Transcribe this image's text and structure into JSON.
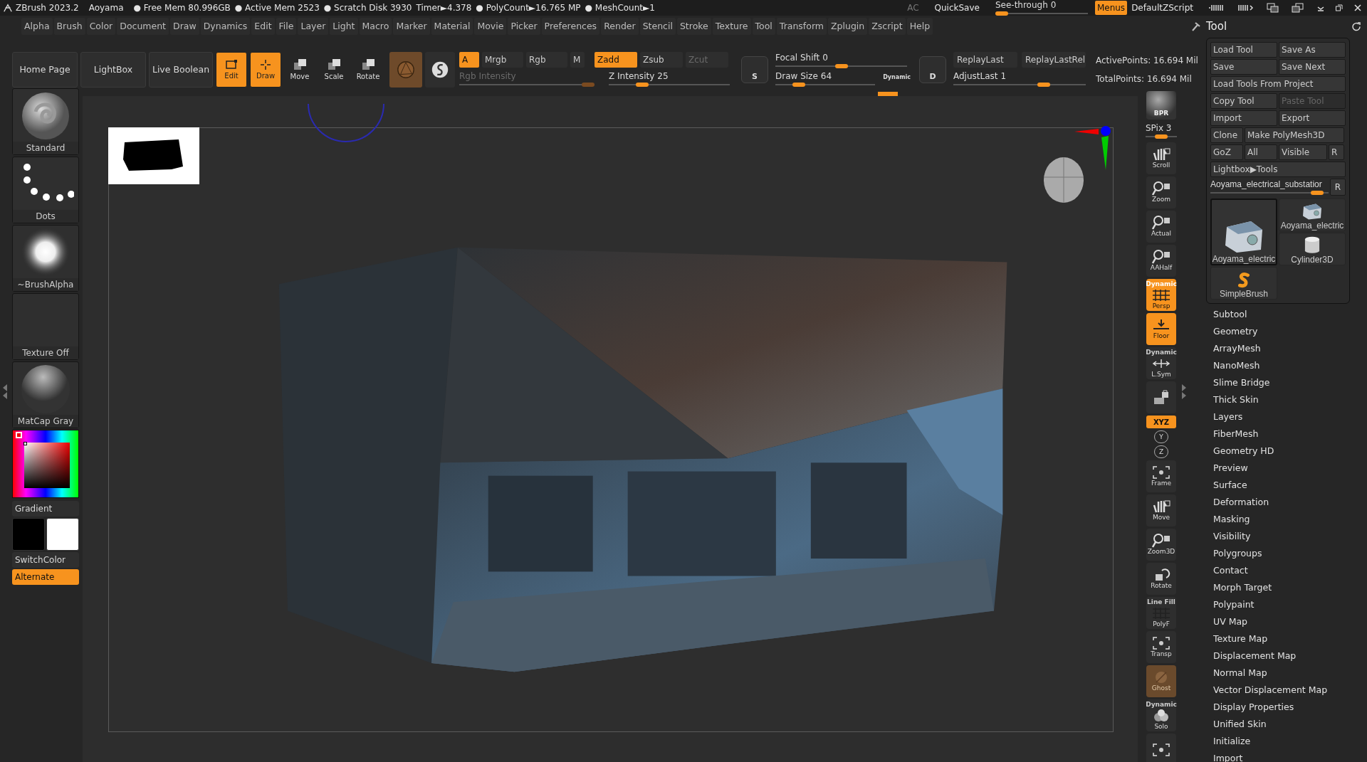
{
  "title_bar": {
    "app": "ZBrush 2023.2",
    "project": "Aoyama",
    "stats": [
      "● Free Mem 80.996GB",
      "● Active Mem 2523",
      "● Scratch Disk 3930",
      "Timer►4.378",
      "● PolyCount►16.765 MP",
      "● MeshCount►1"
    ],
    "ac": "AC",
    "quicksave": "QuickSave",
    "see_through": {
      "label": "See-through",
      "value": "0",
      "level": 0
    },
    "menus": {
      "label": "Menus",
      "on": true
    },
    "script": "DefaultZScript"
  },
  "menu": [
    "Alpha",
    "Brush",
    "Color",
    "Document",
    "Draw",
    "Dynamics",
    "Edit",
    "File",
    "Layer",
    "Light",
    "Macro",
    "Marker",
    "Material",
    "Movie",
    "Picker",
    "Preferences",
    "Render",
    "Stencil",
    "Stroke",
    "Texture",
    "Tool",
    "Transform",
    "Zplugin",
    "Zscript",
    "Help"
  ],
  "shelf": {
    "buttons": [
      "Home Page",
      "LightBox",
      "Live Boolean"
    ],
    "tools": [
      {
        "label": "Edit",
        "selected": true,
        "kind": "edit"
      },
      {
        "label": "Draw",
        "selected": true,
        "kind": "draw"
      },
      {
        "label": "Move",
        "selected": false,
        "kind": "move"
      },
      {
        "label": "Scale",
        "selected": false,
        "kind": "scale"
      },
      {
        "label": "Rotate",
        "selected": false,
        "kind": "rotate"
      }
    ],
    "color_modes": [
      {
        "label": "A",
        "on": true
      },
      {
        "label": "Mrgb",
        "on": false
      },
      {
        "label": "Rgb",
        "on": false
      },
      {
        "label": "M",
        "on": false
      }
    ],
    "z_modes": [
      {
        "label": "Zadd",
        "on": true,
        "disabled": false
      },
      {
        "label": "Zsub",
        "on": false,
        "disabled": false
      },
      {
        "label": "Zcut",
        "on": false,
        "disabled": true
      }
    ],
    "rgb_intensity": {
      "label": "Rgb Intensity",
      "disabled": true,
      "level": 1
    },
    "z_intensity": {
      "label": "Z Intensity",
      "value": "25",
      "level": 0.25
    },
    "s_button": "S",
    "d_button": "D",
    "focal_shift": {
      "label": "Focal Shift",
      "value": "0",
      "level": 0.5
    },
    "draw_size": {
      "label": "Draw Size",
      "value": "64",
      "level": 0.2,
      "tag": "Dynamic"
    },
    "replay": [
      "ReplayLast",
      "ReplayLastRel"
    ],
    "adjust_last": {
      "label": "AdjustLast",
      "value": "1",
      "level": 0.7
    },
    "points": [
      "ActivePoints: 16.694 Mil",
      "TotalPoints: 16.694 Mil"
    ]
  },
  "left_panel": {
    "thumbs": [
      {
        "label": "Standard",
        "kind": "brush"
      },
      {
        "label": "Dots",
        "kind": "stroke"
      },
      {
        "label": "~BrushAlpha",
        "kind": "alpha"
      },
      {
        "label": "Texture Off",
        "kind": "texture"
      },
      {
        "label": "MatCap Gray",
        "kind": "material"
      }
    ],
    "gradient": "Gradient",
    "switch_color": "SwitchColor",
    "alternate": {
      "label": "Alternate",
      "on": true
    }
  },
  "right_toolbar": [
    {
      "kind": "bpr",
      "label": "BPR"
    },
    {
      "kind": "slider",
      "label": "SPix 3",
      "level": 0.5
    },
    {
      "kind": "button",
      "label": "Scroll",
      "on": false
    },
    {
      "kind": "button",
      "label": "Zoom",
      "on": false
    },
    {
      "kind": "button",
      "label": "Actual",
      "on": false
    },
    {
      "kind": "button",
      "label": "AAHalf",
      "on": false
    },
    {
      "kind": "button",
      "label": "Persp",
      "top": "Dynamic",
      "on": true
    },
    {
      "kind": "button",
      "label": "Floor",
      "on": true
    },
    {
      "kind": "button",
      "label": "L.Sym",
      "top": "Dynamic",
      "on": false
    },
    {
      "kind": "button",
      "on": false
    },
    {
      "kind": "small",
      "label": "XYZ",
      "on": true
    },
    {
      "kind": "rot",
      "label": "Y"
    },
    {
      "kind": "rot",
      "label": "Z"
    },
    {
      "kind": "button",
      "label": "Frame",
      "on": false
    },
    {
      "kind": "button",
      "label": "Move",
      "on": false
    },
    {
      "kind": "button",
      "label": "Zoom3D",
      "on": false
    },
    {
      "kind": "button",
      "label": "Rotate",
      "on": false
    },
    {
      "kind": "button",
      "label": "PolyF",
      "top": "Line Fill",
      "on": false
    },
    {
      "kind": "button",
      "label": "Transp",
      "on": false
    },
    {
      "kind": "button",
      "label": "Ghost",
      "on": false
    },
    {
      "kind": "button",
      "label": "Solo",
      "top": "Dynamic",
      "on": false
    },
    {
      "kind": "button",
      "on": false
    }
  ],
  "tool_panel": {
    "title": "Tool",
    "button_rows": [
      [
        {
          "label": "Load Tool",
          "disabled": false
        },
        {
          "label": "Save As",
          "disabled": false
        }
      ],
      [
        {
          "label": "Save",
          "disabled": false
        },
        {
          "label": "Save Next",
          "disabled": false
        }
      ],
      [
        {
          "label": "Load Tools From Project",
          "disabled": false
        }
      ],
      [
        {
          "label": "Copy Tool",
          "disabled": false
        },
        {
          "label": "Paste Tool",
          "disabled": true
        }
      ],
      [
        {
          "label": "Import",
          "disabled": false
        },
        {
          "label": "Export",
          "disabled": false
        }
      ],
      [
        {
          "label": "Clone",
          "disabled": false
        },
        {
          "label": "Make PolyMesh3D",
          "disabled": false
        }
      ],
      [
        {
          "label": "GoZ",
          "disabled": false
        },
        {
          "label": "All",
          "disabled": false
        },
        {
          "label": "Visible",
          "disabled": false
        },
        {
          "label": "R",
          "disabled": false
        }
      ],
      [
        {
          "label": "Lightbox▶Tools",
          "disabled": false
        }
      ]
    ],
    "current_tool": {
      "label": "Aoyama_electrical_substatior",
      "level": 0.95,
      "r": "R"
    },
    "thumbs": [
      {
        "label": "Aoyama_electric",
        "kind": "mesh",
        "selected": true
      },
      {
        "label": "SimpleBrush",
        "kind": "brush",
        "selected": false
      },
      {
        "label": "Aoyama_electric",
        "kind": "mesh",
        "selected": false
      },
      {
        "label": "Cylinder3D",
        "kind": "cylinder",
        "selected": false
      }
    ],
    "sections": [
      "Subtool",
      "Geometry",
      "ArrayMesh",
      "NanoMesh",
      "Slime Bridge",
      "Thick Skin",
      "Layers",
      "FiberMesh",
      "Geometry HD",
      "Preview",
      "Surface",
      "Deformation",
      "Masking",
      "Visibility",
      "Polygroups",
      "Contact",
      "Morph Target",
      "Polypaint",
      "UV Map",
      "Texture Map",
      "Displacement Map",
      "Normal Map",
      "Vector Displacement Map",
      "Display Properties",
      "Unified Skin",
      "Initialize",
      "Import"
    ]
  }
}
